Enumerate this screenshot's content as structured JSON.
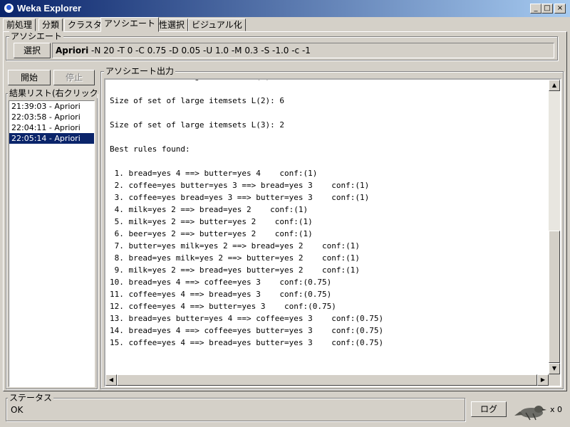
{
  "window": {
    "title": "Weka Explorer",
    "minimize_glyph": "_",
    "maximize_glyph": "□",
    "close_glyph": "×"
  },
  "tabs": [
    {
      "label": "前処理",
      "active": false
    },
    {
      "label": "分類",
      "active": false
    },
    {
      "label": "クラスター",
      "active": false
    },
    {
      "label": "アソシエート",
      "active": true
    },
    {
      "label": "属性選択",
      "active": false
    },
    {
      "label": "ビジュアル化",
      "active": false
    }
  ],
  "associator": {
    "legend": "アソシエート",
    "choose_label": "選択",
    "name": "Apriori",
    "options": "-N 20 -T 0 -C 0.75 -D 0.05 -U 1.0 -M 0.3 -S -1.0 -c -1"
  },
  "controls": {
    "start_label": "開始",
    "stop_label": "停止"
  },
  "result_list": {
    "legend": "結果リスト(右クリックで...",
    "items": [
      {
        "label": "21:39:03 - Apriori",
        "selected": false
      },
      {
        "label": "22:03:58 - Apriori",
        "selected": false
      },
      {
        "label": "22:04:11 - Apriori",
        "selected": false
      },
      {
        "label": "22:05:14 - Apriori",
        "selected": true
      }
    ]
  },
  "output": {
    "legend": "アソシエート出力",
    "lines": [
      "Size of set of large itemsets L(1): 8",
      "",
      "Size of set of large itemsets L(2): 6",
      "",
      "Size of set of large itemsets L(3): 2",
      "",
      "Best rules found:",
      "",
      " 1. bread=yes 4 ==> butter=yes 4    conf:(1)",
      " 2. coffee=yes butter=yes 3 ==> bread=yes 3    conf:(1)",
      " 3. coffee=yes bread=yes 3 ==> butter=yes 3    conf:(1)",
      " 4. milk=yes 2 ==> bread=yes 2    conf:(1)",
      " 5. milk=yes 2 ==> butter=yes 2    conf:(1)",
      " 6. beer=yes 2 ==> butter=yes 2    conf:(1)",
      " 7. butter=yes milk=yes 2 ==> bread=yes 2    conf:(1)",
      " 8. bread=yes milk=yes 2 ==> butter=yes 2    conf:(1)",
      " 9. milk=yes 2 ==> bread=yes butter=yes 2    conf:(1)",
      "10. bread=yes 4 ==> coffee=yes 3    conf:(0.75)",
      "11. coffee=yes 4 ==> bread=yes 3    conf:(0.75)",
      "12. coffee=yes 4 ==> butter=yes 3    conf:(0.75)",
      "13. bread=yes butter=yes 4 ==> coffee=yes 3    conf:(0.75)",
      "14. bread=yes 4 ==> coffee=yes butter=yes 3    conf:(0.75)",
      "15. coffee=yes 4 ==> bread=yes butter=yes 3    conf:(0.75)"
    ]
  },
  "status": {
    "legend": "ステータス",
    "text": "OK",
    "log_label": "ログ",
    "tasks": "x 0"
  },
  "colors": {
    "title_start": "#0a246a",
    "title_end": "#a6caf0",
    "selection": "#0a246a",
    "face": "#d4d0c8"
  }
}
